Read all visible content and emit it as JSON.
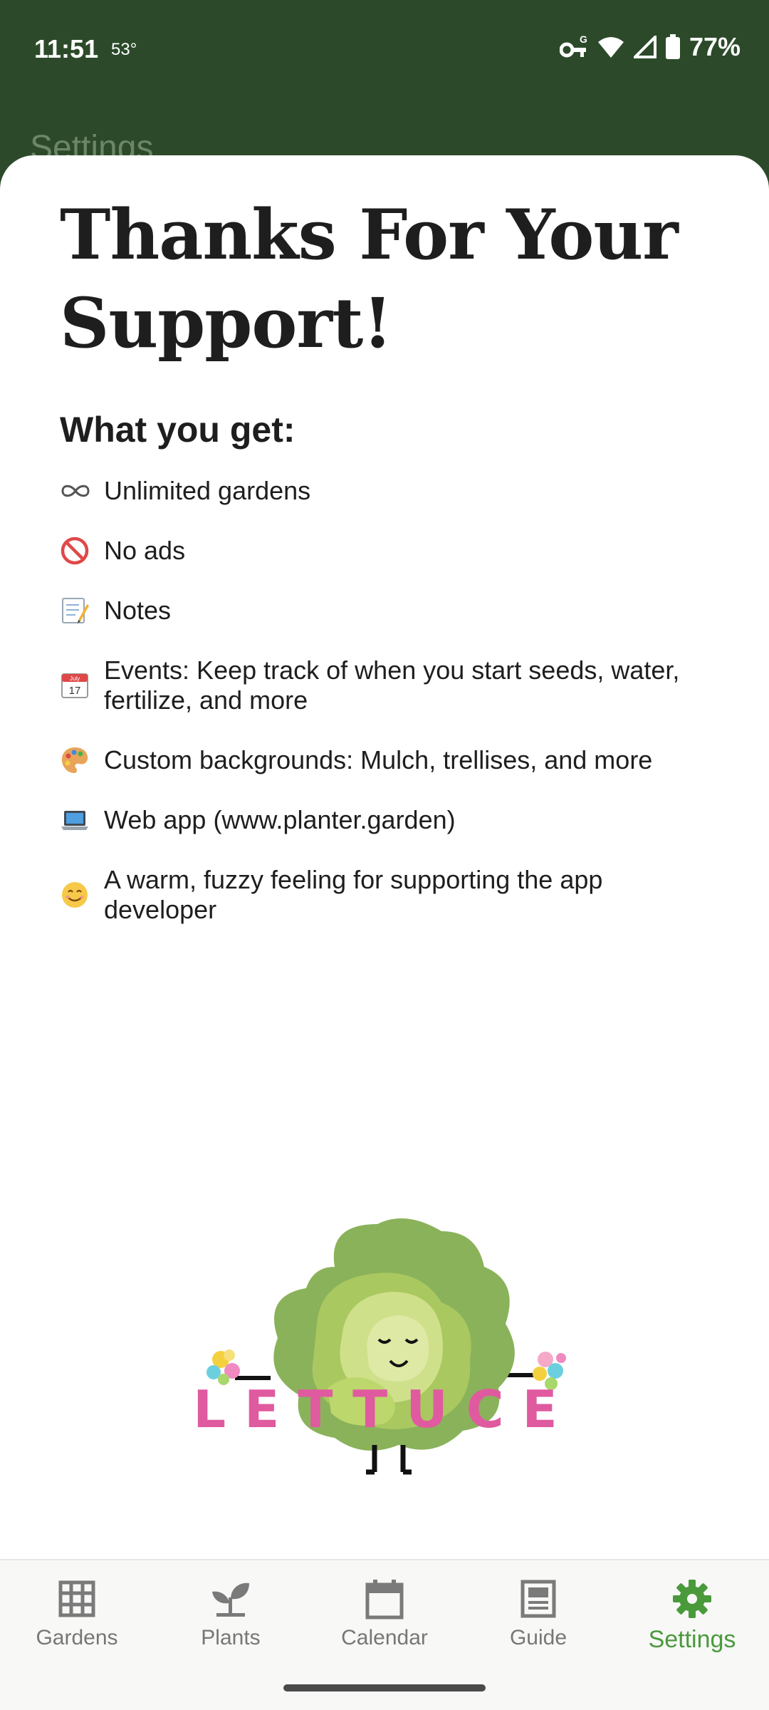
{
  "status_bar": {
    "time": "11:51",
    "temperature": "53°",
    "battery": "77%"
  },
  "behind_title": "Settings",
  "sheet": {
    "title": "Thanks For Your Support!",
    "benefits_heading": "What you get:",
    "benefits": [
      {
        "icon": "infinity-icon",
        "text": "Unlimited gardens"
      },
      {
        "icon": "no-entry-icon",
        "text": "No ads"
      },
      {
        "icon": "memo-icon",
        "text": "Notes"
      },
      {
        "icon": "calendar-icon",
        "text": "Events: Keep track of when you start seeds, water, fertilize, and more"
      },
      {
        "icon": "palette-icon",
        "text": "Custom backgrounds: Mulch, trellises, and more"
      },
      {
        "icon": "laptop-icon",
        "text": "Web app (www.planter.garden)"
      },
      {
        "icon": "smile-icon",
        "text": "A warm, fuzzy feeling for supporting the app developer"
      }
    ],
    "calendar_emoji": {
      "month": "July",
      "day": "17"
    },
    "mascot_label": "LETTUCE"
  },
  "nav": {
    "items": [
      {
        "label": "Gardens",
        "icon": "grid-icon"
      },
      {
        "label": "Plants",
        "icon": "sprout-icon"
      },
      {
        "label": "Calendar",
        "icon": "calendar-icon"
      },
      {
        "label": "Guide",
        "icon": "guide-icon"
      },
      {
        "label": "Settings",
        "icon": "gear-icon"
      }
    ],
    "active": "Settings"
  },
  "colors": {
    "header_green": "#2c4a2a",
    "active_green": "#4a9a3c",
    "lettuce_pink": "#e05aa0"
  }
}
